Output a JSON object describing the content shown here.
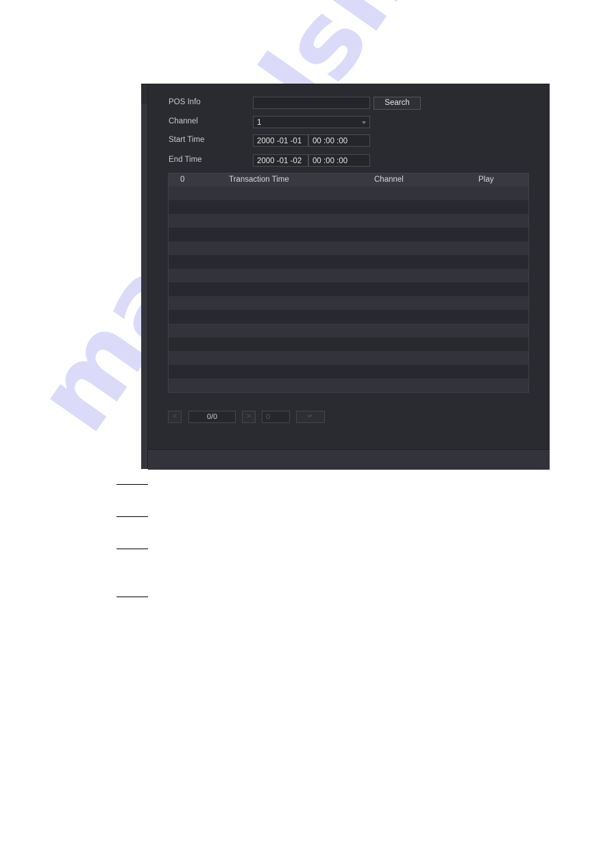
{
  "form": {
    "pos_info_label": "POS Info",
    "pos_info_value": "",
    "search_button": "Search",
    "channel_label": "Channel",
    "channel_value": "1",
    "start_time_label": "Start Time",
    "start_date": "2000 -01 -01",
    "start_clock": "00 :00 :00",
    "end_time_label": "End Time",
    "end_date": "2000 -01 -02",
    "end_clock": "00 :00 :00"
  },
  "table": {
    "columns": [
      "0",
      "Transaction Time",
      "Channel",
      "Play"
    ],
    "rows": []
  },
  "pager": {
    "prev_icon": "chevron-left-icon",
    "page_display": "0/0",
    "next_icon": "chevron-right-icon",
    "jump_value": "0",
    "go_icon": "go-icon"
  },
  "document": {
    "step_markers": 4,
    "watermark": "manualslib"
  }
}
